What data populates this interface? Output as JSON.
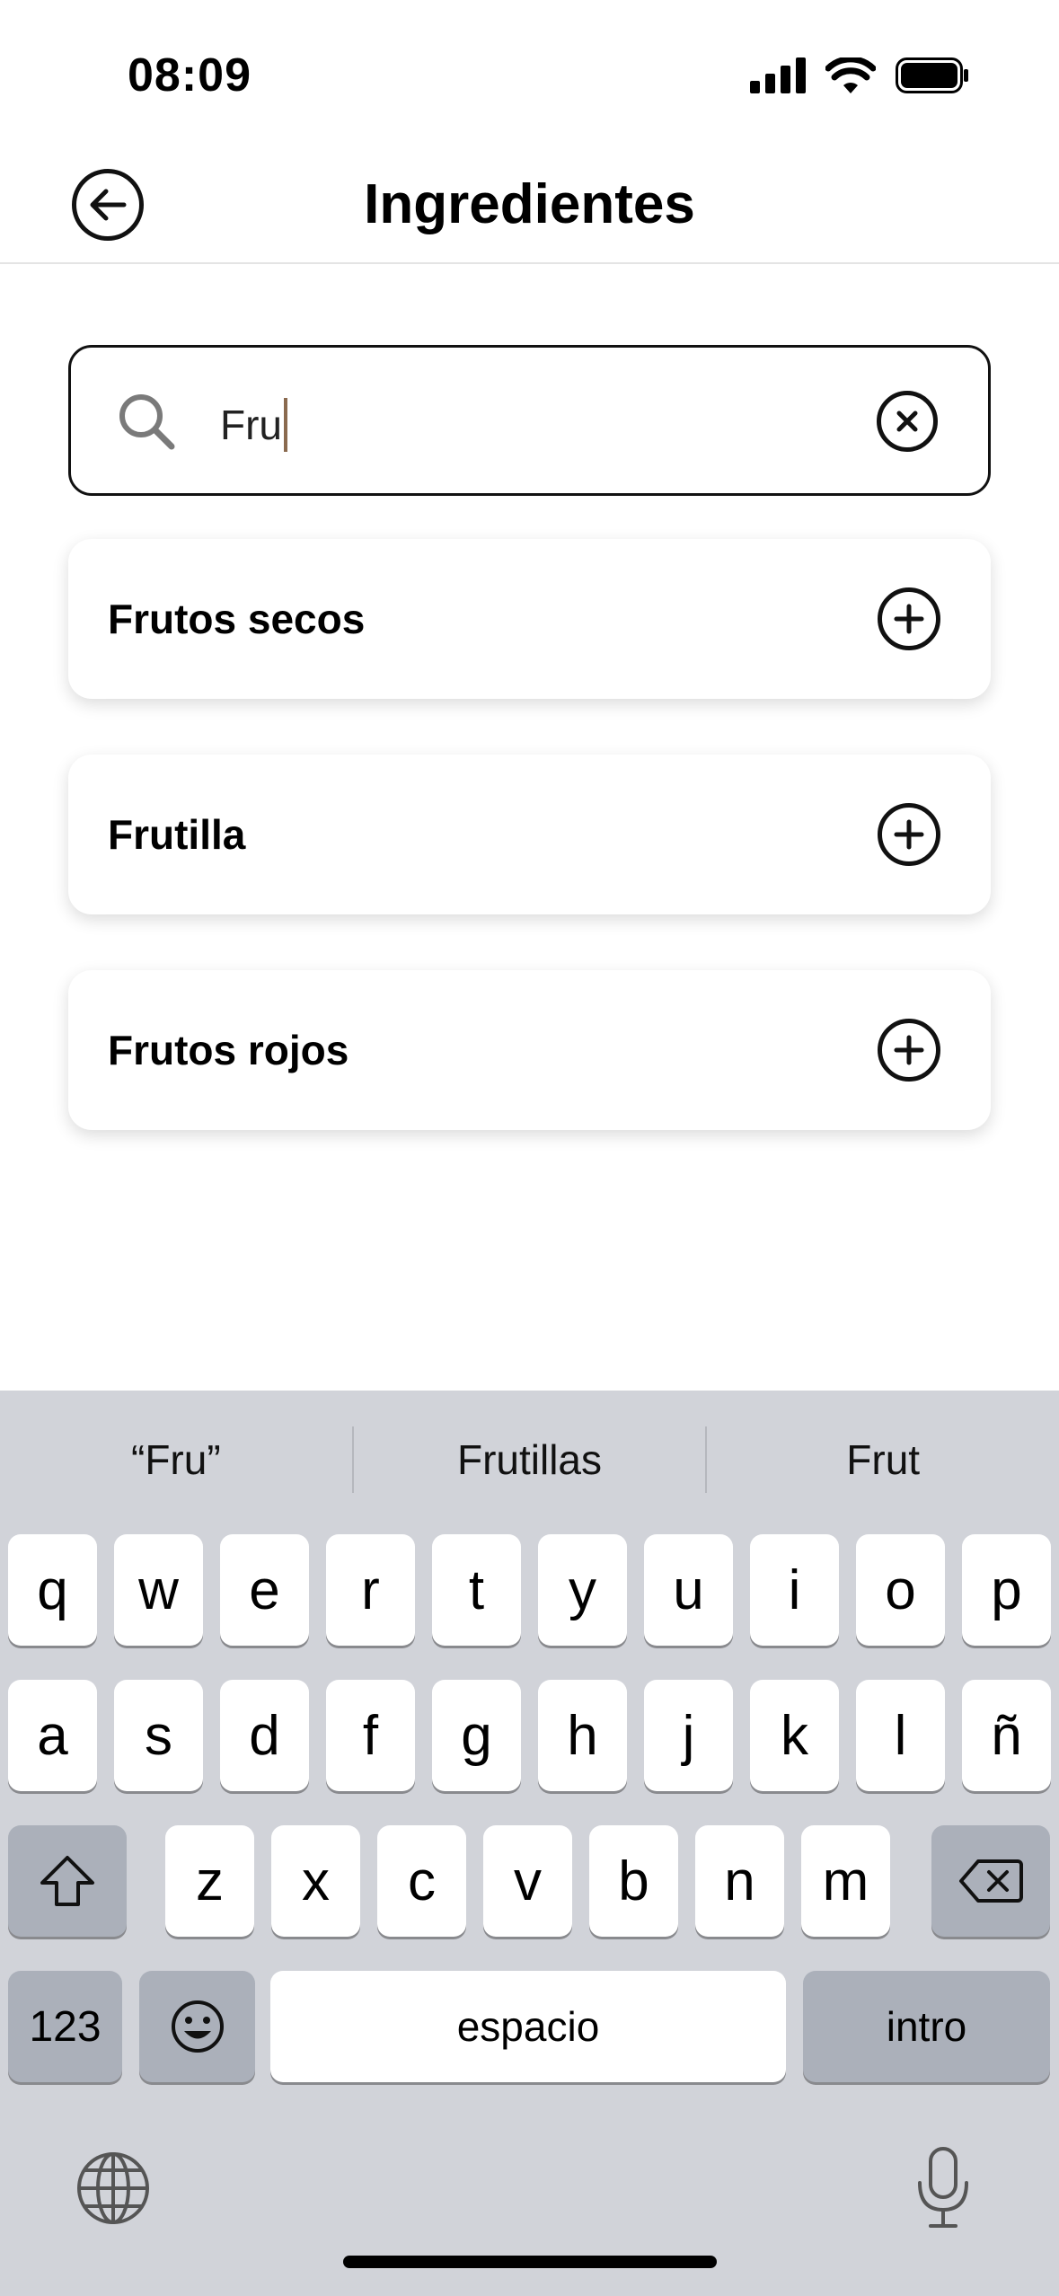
{
  "status_bar": {
    "time": "08:09"
  },
  "header": {
    "title": "Ingredientes"
  },
  "search": {
    "value": "Fru"
  },
  "results": [
    {
      "label": "Frutos secos"
    },
    {
      "label": "Frutilla"
    },
    {
      "label": "Frutos rojos"
    }
  ],
  "keyboard": {
    "suggestions": [
      "“Fru”",
      "Frutillas",
      "Frut"
    ],
    "row1": [
      "q",
      "w",
      "e",
      "r",
      "t",
      "y",
      "u",
      "i",
      "o",
      "p"
    ],
    "row2": [
      "a",
      "s",
      "d",
      "f",
      "g",
      "h",
      "j",
      "k",
      "l",
      "ñ"
    ],
    "row3": [
      "z",
      "x",
      "c",
      "v",
      "b",
      "n",
      "m"
    ],
    "numbers_label": "123",
    "space_label": "espacio",
    "return_label": "intro"
  }
}
